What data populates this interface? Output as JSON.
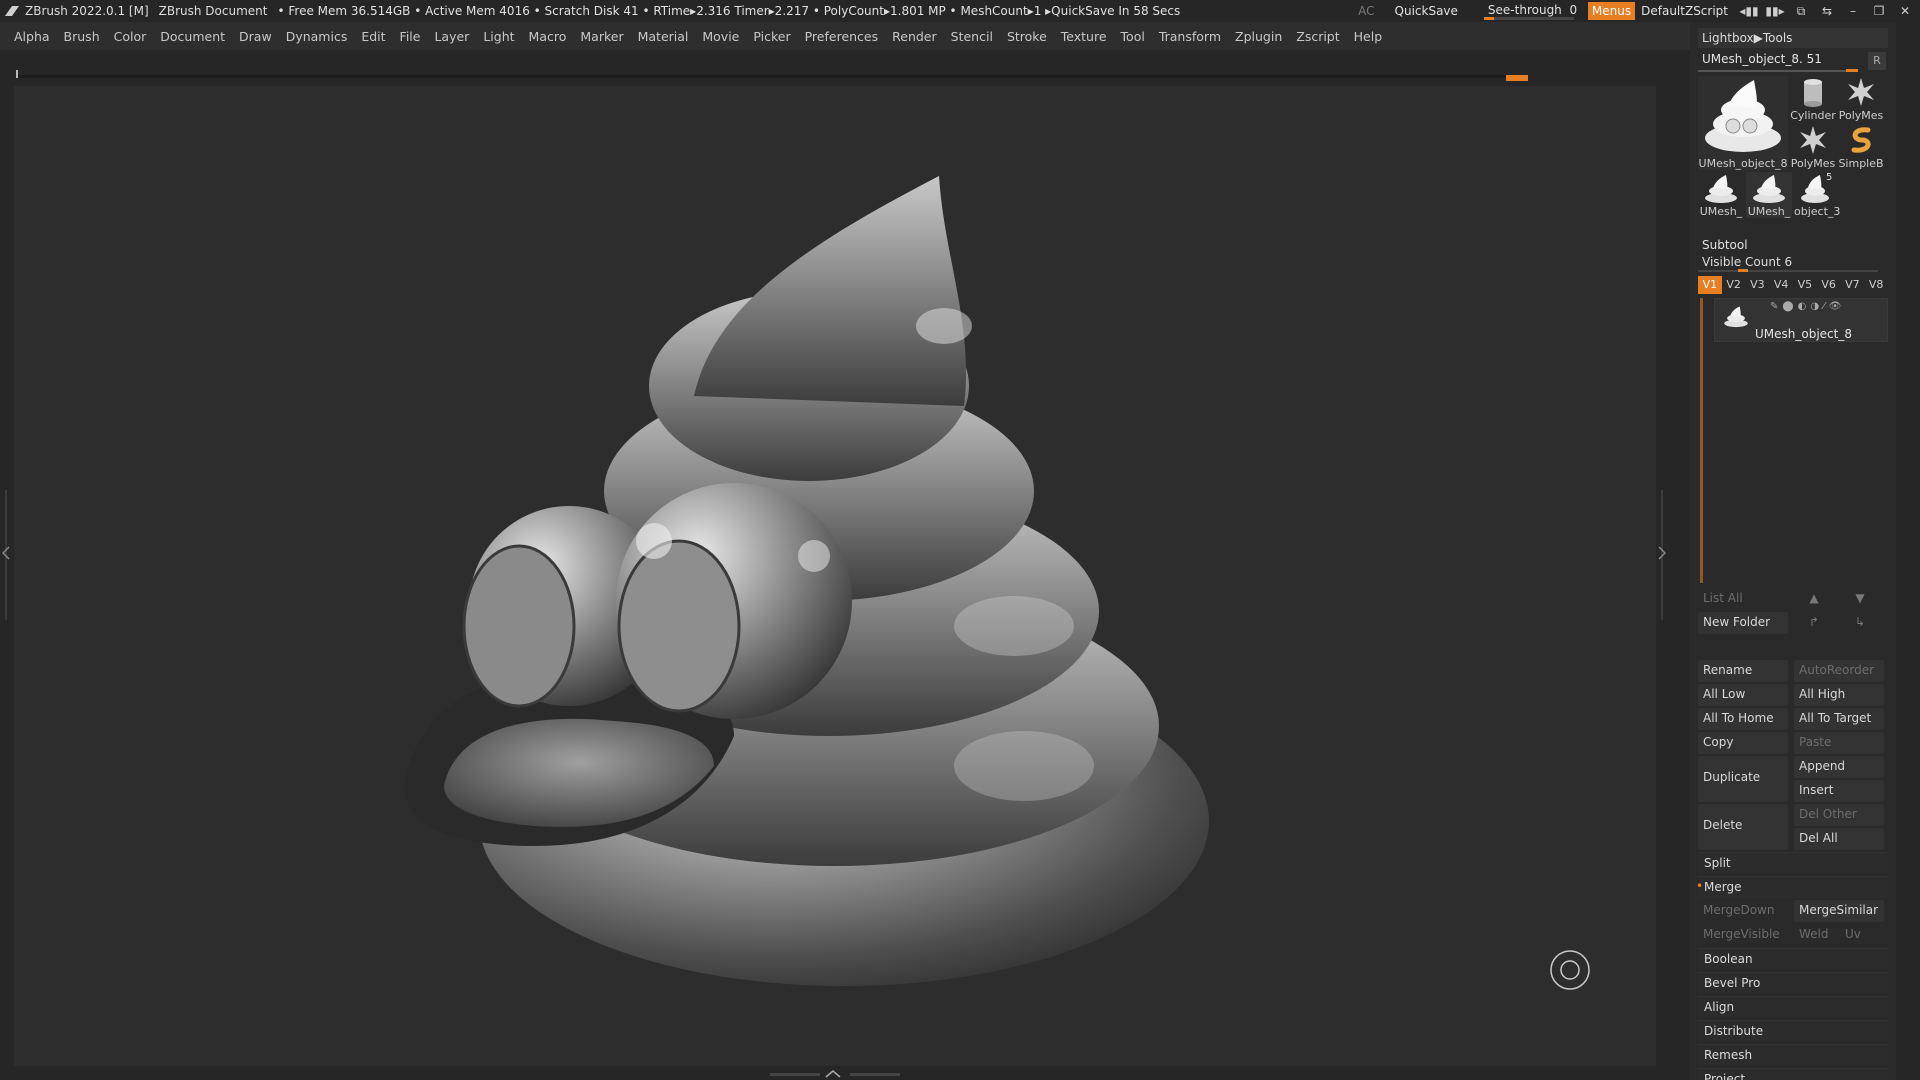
{
  "titlebar": {
    "app": "ZBrush 2022.0.1 [M]",
    "document": "ZBrush Document",
    "stats": "• Free Mem 36.514GB • Active Mem 4016 • Scratch Disk 41 •  RTime▸2.316 Timer▸2.217 • PolyCount▸1.801 MP  • MeshCount▸1  ▸QuickSave In 58 Secs",
    "ac": "AC",
    "quicksave": "QuickSave",
    "seethrough_label": "See-through",
    "seethrough_value": "0",
    "menus": "Menus",
    "default_zscript": "DefaultZScript"
  },
  "menubar": [
    "Alpha",
    "Brush",
    "Color",
    "Document",
    "Draw",
    "Dynamics",
    "Edit",
    "File",
    "Layer",
    "Light",
    "Macro",
    "Marker",
    "Material",
    "Movie",
    "Picker",
    "Preferences",
    "Render",
    "Stencil",
    "Stroke",
    "Texture",
    "Tool",
    "Transform",
    "Zplugin",
    "Zscript",
    "Help"
  ],
  "tool_panel": {
    "lightbox_tools": "Lightbox▶Tools",
    "tool_name": "UMesh_object_8. 51",
    "r_button": "R",
    "thumbnails": [
      {
        "label": "UMesh_object_8",
        "icon": "poo-icon"
      },
      {
        "label": "Cylinder",
        "icon": "cylinder-icon"
      },
      {
        "label": "PolyMes",
        "icon": "star-icon"
      },
      {
        "label": "PolyMes",
        "icon": "star-icon"
      },
      {
        "label": "SimpleB",
        "icon": "simplebrush-icon"
      },
      {
        "label": "UMesh_",
        "icon": "poo-icon"
      },
      {
        "label": "UMesh_",
        "icon": "poo-icon"
      },
      {
        "label": "object_3",
        "icon": "poo-icon",
        "badge": "5"
      }
    ]
  },
  "subtool": {
    "header": "Subtool",
    "visible_count": "Visible Count 6",
    "vtabs": [
      "V1",
      "V2",
      "V3",
      "V4",
      "V5",
      "V6",
      "V7",
      "V8"
    ],
    "item_name": "UMesh_object_8",
    "list_all": "List All",
    "new_folder": "New Folder",
    "rename": "Rename",
    "autoreorder": "AutoReorder",
    "all_low": "All Low",
    "all_high": "All High",
    "all_to_home": "All To Home",
    "all_to_target": "All To Target",
    "copy": "Copy",
    "paste": "Paste",
    "duplicate": "Duplicate",
    "append": "Append",
    "insert": "Insert",
    "delete": "Delete",
    "del_other": "Del Other",
    "del_all": "Del All",
    "split": "Split",
    "merge": "Merge",
    "mergedown": "MergeDown",
    "mergesimilar": "MergeSimilar",
    "mergevisible": "MergeVisible",
    "weld": "Weld",
    "uv": "Uv",
    "boolean": "Boolean",
    "bevel_pro": "Bevel Pro",
    "align": "Align",
    "distribute": "Distribute",
    "remesh": "Remesh",
    "project": "Project"
  },
  "colors": {
    "accent": "#e67e22",
    "background": "#262626",
    "canvas": "#2d2d2d"
  }
}
